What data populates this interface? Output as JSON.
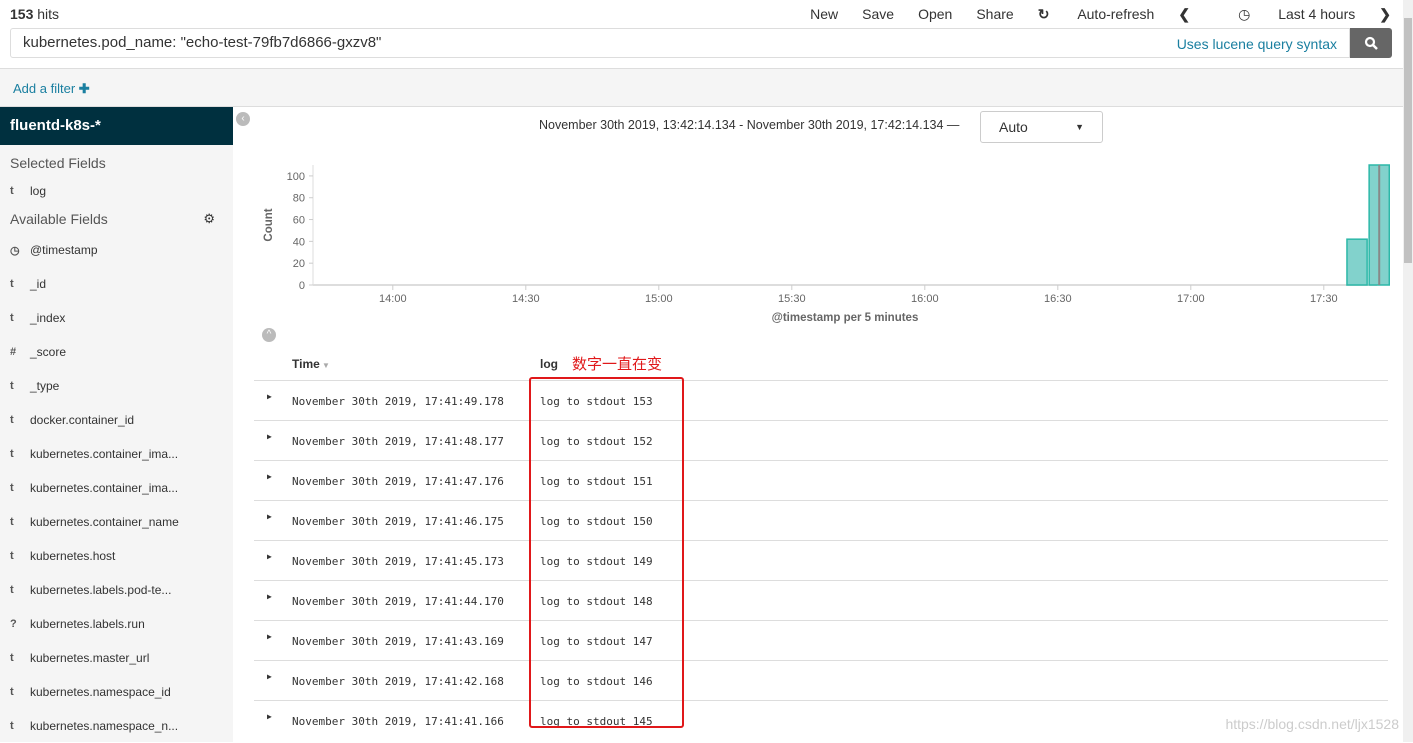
{
  "header": {
    "hits_count": "153",
    "hits_label": " hits",
    "nav": [
      "New",
      "Save",
      "Open",
      "Share",
      "Auto-refresh"
    ],
    "time_picker": "Last 4 hours"
  },
  "query": {
    "value": "kubernetes.pod_name: \"echo-test-79fb7d6866-gxzv8\"",
    "hint": "Uses lucene query syntax"
  },
  "filter": {
    "add_label": "Add a filter"
  },
  "sidebar": {
    "index": "fluentd-k8s-*",
    "selected_title": "Selected Fields",
    "selected": [
      {
        "type": "t",
        "name": "log"
      }
    ],
    "available_title": "Available Fields",
    "available": [
      {
        "type": "clock",
        "name": "@timestamp"
      },
      {
        "type": "t",
        "name": "_id"
      },
      {
        "type": "t",
        "name": "_index"
      },
      {
        "type": "#",
        "name": "_score"
      },
      {
        "type": "t",
        "name": "_type"
      },
      {
        "type": "t",
        "name": "docker.container_id"
      },
      {
        "type": "t",
        "name": "kubernetes.container_ima..."
      },
      {
        "type": "t",
        "name": "kubernetes.container_ima..."
      },
      {
        "type": "t",
        "name": "kubernetes.container_name"
      },
      {
        "type": "t",
        "name": "kubernetes.host"
      },
      {
        "type": "t",
        "name": "kubernetes.labels.pod-te..."
      },
      {
        "type": "?",
        "name": "kubernetes.labels.run"
      },
      {
        "type": "t",
        "name": "kubernetes.master_url"
      },
      {
        "type": "t",
        "name": "kubernetes.namespace_id"
      },
      {
        "type": "t",
        "name": "kubernetes.namespace_n..."
      }
    ]
  },
  "range": {
    "text": "November 30th 2019, 13:42:14.134 - November 30th 2019, 17:42:14.134 —",
    "interval": "Auto"
  },
  "chart_data": {
    "type": "bar",
    "xlabel": "@timestamp per 5 minutes",
    "ylabel": "Count",
    "xlim_minutes": [
      822,
      1062
    ],
    "ylim": [
      0,
      110
    ],
    "yticks": [
      0,
      20,
      40,
      60,
      80,
      100
    ],
    "xticks": [
      {
        "label": "14:00",
        "min": 840
      },
      {
        "label": "14:30",
        "min": 870
      },
      {
        "label": "15:00",
        "min": 900
      },
      {
        "label": "15:30",
        "min": 930
      },
      {
        "label": "16:00",
        "min": 960
      },
      {
        "label": "16:30",
        "min": 990
      },
      {
        "label": "17:00",
        "min": 1020
      },
      {
        "label": "17:30",
        "min": 1050
      }
    ],
    "bars": [
      {
        "start": "17:35",
        "start_min": 1055,
        "value": 42
      },
      {
        "start": "17:40",
        "start_min": 1060,
        "value": 110
      }
    ],
    "bar_color": "#82d2cc",
    "bar_stroke": "#2cb8a8"
  },
  "table": {
    "headers": {
      "time": "Time",
      "log": "log"
    },
    "annotation": "数字一直在变",
    "rows": [
      {
        "time": "November 30th 2019, 17:41:49.178",
        "log": "log to stdout 153"
      },
      {
        "time": "November 30th 2019, 17:41:48.177",
        "log": "log to stdout 152"
      },
      {
        "time": "November 30th 2019, 17:41:47.176",
        "log": "log to stdout 151"
      },
      {
        "time": "November 30th 2019, 17:41:46.175",
        "log": "log to stdout 150"
      },
      {
        "time": "November 30th 2019, 17:41:45.173",
        "log": "log to stdout 149"
      },
      {
        "time": "November 30th 2019, 17:41:44.170",
        "log": "log to stdout 148"
      },
      {
        "time": "November 30th 2019, 17:41:43.169",
        "log": "log to stdout 147"
      },
      {
        "time": "November 30th 2019, 17:41:42.168",
        "log": "log to stdout 146"
      },
      {
        "time": "November 30th 2019, 17:41:41.166",
        "log": "log to stdout 145"
      }
    ]
  },
  "watermark": "https://blog.csdn.net/ljx1528"
}
